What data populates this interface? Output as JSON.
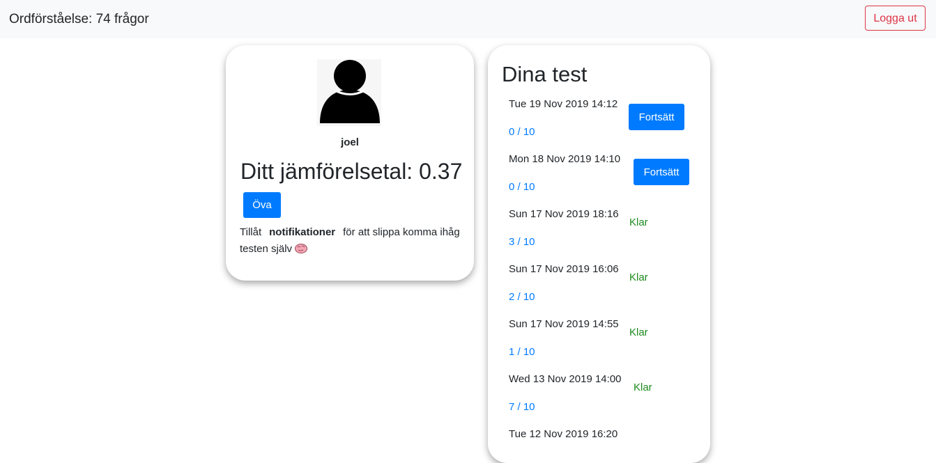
{
  "navbar": {
    "title": "Ordförståelse: 74 frågor",
    "logout_label": "Logga ut"
  },
  "profile": {
    "avatar_icon": "user-silhouette-icon",
    "username": "joel",
    "score_text": "Ditt jämförelsetal: 0.37",
    "practice_label": "Öva",
    "notif_prefix": "Tillåt",
    "notif_bold": "notifikationer",
    "notif_suffix": "för att slippa komma ihåg testen själv",
    "notif_icon": "brain-icon"
  },
  "tests": {
    "title": "Dina test",
    "items": [
      {
        "date": "Tue 19 Nov 2019 14:12",
        "score": "0 / 10",
        "action": "Fortsätt"
      },
      {
        "date": "Mon 18 Nov 2019 14:10",
        "score": "0 / 10",
        "action": "Fortsätt"
      },
      {
        "date": "Sun 17 Nov 2019 18:16",
        "score": "3 / 10",
        "status": "Klar"
      },
      {
        "date": "Sun 17 Nov 2019 16:06",
        "score": "2 / 10",
        "status": "Klar"
      },
      {
        "date": "Sun 17 Nov 2019 14:55",
        "score": "1 / 10",
        "status": "Klar"
      },
      {
        "date": "Wed 13 Nov 2019 14:00",
        "score": "7 / 10",
        "status": "Klar"
      },
      {
        "date": "Tue 12 Nov 2019 16:20"
      }
    ]
  },
  "colors": {
    "primary": "#007bff",
    "danger": "#dc3545",
    "success": "#1e8a1e",
    "navbar_bg": "#f8f9fa"
  }
}
